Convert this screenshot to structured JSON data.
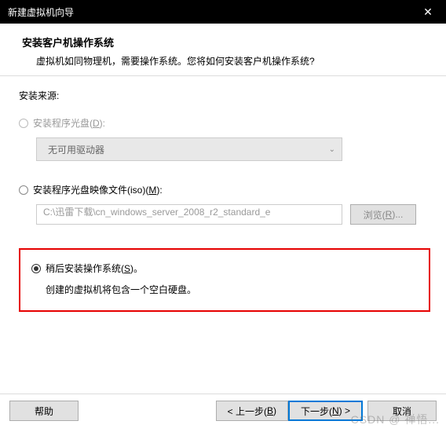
{
  "titlebar": {
    "title": "新建虚拟机向导",
    "close": "✕"
  },
  "header": {
    "title": "安装客户机操作系统",
    "subtitle": "虚拟机如同物理机，需要操作系统。您将如何安装客户机操作系统?"
  },
  "content": {
    "source_label": "安装来源:",
    "opt_disc": {
      "label_pre": "安装程序光盘(",
      "label_key": "D",
      "label_post": "):",
      "dropdown_value": "无可用驱动器",
      "chevron": "⌄"
    },
    "opt_iso": {
      "label_pre": "安装程序光盘映像文件(iso)(",
      "label_key": "M",
      "label_post": "):",
      "file_value": "C:\\迅雷下载\\cn_windows_server_2008_r2_standard_e",
      "browse_pre": "浏览(",
      "browse_key": "R",
      "browse_post": ")..."
    },
    "opt_later": {
      "label_pre": "稍后安装操作系统(",
      "label_key": "S",
      "label_post": ")。",
      "desc": "创建的虚拟机将包含一个空白硬盘。"
    }
  },
  "buttons": {
    "help": "帮助",
    "back_pre": "< 上一步(",
    "back_key": "B",
    "back_post": ")",
    "next_pre": "下一步(",
    "next_key": "N",
    "next_post": ") >",
    "cancel": "取消"
  },
  "watermark": "CSDN @ 禅悟..."
}
